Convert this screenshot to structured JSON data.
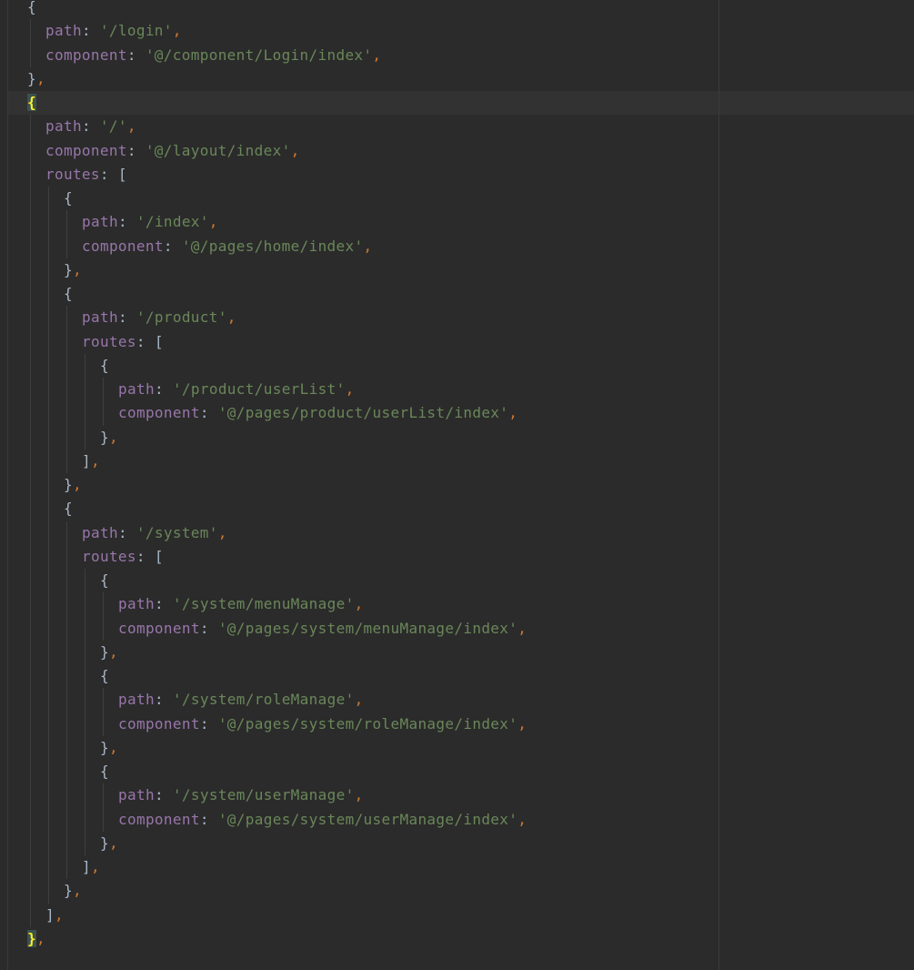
{
  "editor": {
    "language": "javascript",
    "colors": {
      "background": "#2b2b2b",
      "key": "#9876aa",
      "string": "#6a8759",
      "comma": "#cc7832",
      "bracket": "#a9b7c6",
      "matched_brace": "#ffef28",
      "current_line": "#323232"
    },
    "current_line_index": 4,
    "lines": [
      {
        "indent": 0,
        "tokens": [
          {
            "t": "b",
            "v": "{"
          }
        ]
      },
      {
        "indent": 1,
        "tokens": [
          {
            "t": "k",
            "v": "path"
          },
          {
            "t": "p",
            "v": ": "
          },
          {
            "t": "s",
            "v": "'/login'"
          },
          {
            "t": "c",
            "v": ","
          }
        ]
      },
      {
        "indent": 1,
        "tokens": [
          {
            "t": "k",
            "v": "component"
          },
          {
            "t": "p",
            "v": ": "
          },
          {
            "t": "s",
            "v": "'@/component/Login/index'"
          },
          {
            "t": "c",
            "v": ","
          }
        ]
      },
      {
        "indent": 0,
        "tokens": [
          {
            "t": "b",
            "v": "}"
          },
          {
            "t": "c",
            "v": ","
          }
        ]
      },
      {
        "indent": 0,
        "tokens": [
          {
            "t": "bm",
            "v": "{"
          }
        ]
      },
      {
        "indent": 1,
        "tokens": [
          {
            "t": "k",
            "v": "path"
          },
          {
            "t": "p",
            "v": ": "
          },
          {
            "t": "s",
            "v": "'/'"
          },
          {
            "t": "c",
            "v": ","
          }
        ]
      },
      {
        "indent": 1,
        "tokens": [
          {
            "t": "k",
            "v": "component"
          },
          {
            "t": "p",
            "v": ": "
          },
          {
            "t": "s",
            "v": "'@/layout/index'"
          },
          {
            "t": "c",
            "v": ","
          }
        ]
      },
      {
        "indent": 1,
        "tokens": [
          {
            "t": "k",
            "v": "routes"
          },
          {
            "t": "p",
            "v": ": "
          },
          {
            "t": "b",
            "v": "["
          }
        ]
      },
      {
        "indent": 2,
        "tokens": [
          {
            "t": "b",
            "v": "{"
          }
        ]
      },
      {
        "indent": 3,
        "tokens": [
          {
            "t": "k",
            "v": "path"
          },
          {
            "t": "p",
            "v": ": "
          },
          {
            "t": "s",
            "v": "'/index'"
          },
          {
            "t": "c",
            "v": ","
          }
        ]
      },
      {
        "indent": 3,
        "tokens": [
          {
            "t": "k",
            "v": "component"
          },
          {
            "t": "p",
            "v": ": "
          },
          {
            "t": "s",
            "v": "'@/pages/home/index'"
          },
          {
            "t": "c",
            "v": ","
          }
        ]
      },
      {
        "indent": 2,
        "tokens": [
          {
            "t": "b",
            "v": "}"
          },
          {
            "t": "c",
            "v": ","
          }
        ]
      },
      {
        "indent": 2,
        "tokens": [
          {
            "t": "b",
            "v": "{"
          }
        ]
      },
      {
        "indent": 3,
        "tokens": [
          {
            "t": "k",
            "v": "path"
          },
          {
            "t": "p",
            "v": ": "
          },
          {
            "t": "s",
            "v": "'/product'"
          },
          {
            "t": "c",
            "v": ","
          }
        ]
      },
      {
        "indent": 3,
        "tokens": [
          {
            "t": "k",
            "v": "routes"
          },
          {
            "t": "p",
            "v": ": "
          },
          {
            "t": "b",
            "v": "["
          }
        ]
      },
      {
        "indent": 4,
        "tokens": [
          {
            "t": "b",
            "v": "{"
          }
        ]
      },
      {
        "indent": 5,
        "tokens": [
          {
            "t": "k",
            "v": "path"
          },
          {
            "t": "p",
            "v": ": "
          },
          {
            "t": "s",
            "v": "'/product/userList'"
          },
          {
            "t": "c",
            "v": ","
          }
        ]
      },
      {
        "indent": 5,
        "tokens": [
          {
            "t": "k",
            "v": "component"
          },
          {
            "t": "p",
            "v": ": "
          },
          {
            "t": "s",
            "v": "'@/pages/product/userList/index'"
          },
          {
            "t": "c",
            "v": ","
          }
        ]
      },
      {
        "indent": 4,
        "tokens": [
          {
            "t": "b",
            "v": "}"
          },
          {
            "t": "c",
            "v": ","
          }
        ]
      },
      {
        "indent": 3,
        "tokens": [
          {
            "t": "b",
            "v": "]"
          },
          {
            "t": "c",
            "v": ","
          }
        ]
      },
      {
        "indent": 2,
        "tokens": [
          {
            "t": "b",
            "v": "}"
          },
          {
            "t": "c",
            "v": ","
          }
        ]
      },
      {
        "indent": 2,
        "tokens": [
          {
            "t": "b",
            "v": "{"
          }
        ]
      },
      {
        "indent": 3,
        "tokens": [
          {
            "t": "k",
            "v": "path"
          },
          {
            "t": "p",
            "v": ": "
          },
          {
            "t": "s",
            "v": "'/system'"
          },
          {
            "t": "c",
            "v": ","
          }
        ]
      },
      {
        "indent": 3,
        "tokens": [
          {
            "t": "k",
            "v": "routes"
          },
          {
            "t": "p",
            "v": ": "
          },
          {
            "t": "b",
            "v": "["
          }
        ]
      },
      {
        "indent": 4,
        "tokens": [
          {
            "t": "b",
            "v": "{"
          }
        ]
      },
      {
        "indent": 5,
        "tokens": [
          {
            "t": "k",
            "v": "path"
          },
          {
            "t": "p",
            "v": ": "
          },
          {
            "t": "s",
            "v": "'/system/menuManage'"
          },
          {
            "t": "c",
            "v": ","
          }
        ]
      },
      {
        "indent": 5,
        "tokens": [
          {
            "t": "k",
            "v": "component"
          },
          {
            "t": "p",
            "v": ": "
          },
          {
            "t": "s",
            "v": "'@/pages/system/menuManage/index'"
          },
          {
            "t": "c",
            "v": ","
          }
        ]
      },
      {
        "indent": 4,
        "tokens": [
          {
            "t": "b",
            "v": "}"
          },
          {
            "t": "c",
            "v": ","
          }
        ]
      },
      {
        "indent": 4,
        "tokens": [
          {
            "t": "b",
            "v": "{"
          }
        ]
      },
      {
        "indent": 5,
        "tokens": [
          {
            "t": "k",
            "v": "path"
          },
          {
            "t": "p",
            "v": ": "
          },
          {
            "t": "s",
            "v": "'/system/roleManage'"
          },
          {
            "t": "c",
            "v": ","
          }
        ]
      },
      {
        "indent": 5,
        "tokens": [
          {
            "t": "k",
            "v": "component"
          },
          {
            "t": "p",
            "v": ": "
          },
          {
            "t": "s",
            "v": "'@/pages/system/roleManage/index'"
          },
          {
            "t": "c",
            "v": ","
          }
        ]
      },
      {
        "indent": 4,
        "tokens": [
          {
            "t": "b",
            "v": "}"
          },
          {
            "t": "c",
            "v": ","
          }
        ]
      },
      {
        "indent": 4,
        "tokens": [
          {
            "t": "b",
            "v": "{"
          }
        ]
      },
      {
        "indent": 5,
        "tokens": [
          {
            "t": "k",
            "v": "path"
          },
          {
            "t": "p",
            "v": ": "
          },
          {
            "t": "s",
            "v": "'/system/userManage'"
          },
          {
            "t": "c",
            "v": ","
          }
        ]
      },
      {
        "indent": 5,
        "tokens": [
          {
            "t": "k",
            "v": "component"
          },
          {
            "t": "p",
            "v": ": "
          },
          {
            "t": "s",
            "v": "'@/pages/system/userManage/index'"
          },
          {
            "t": "c",
            "v": ","
          }
        ]
      },
      {
        "indent": 4,
        "tokens": [
          {
            "t": "b",
            "v": "}"
          },
          {
            "t": "c",
            "v": ","
          }
        ]
      },
      {
        "indent": 3,
        "tokens": [
          {
            "t": "b",
            "v": "]"
          },
          {
            "t": "c",
            "v": ","
          }
        ]
      },
      {
        "indent": 2,
        "tokens": [
          {
            "t": "b",
            "v": "}"
          },
          {
            "t": "c",
            "v": ","
          }
        ]
      },
      {
        "indent": 1,
        "tokens": [
          {
            "t": "b",
            "v": "]"
          },
          {
            "t": "c",
            "v": ","
          }
        ]
      },
      {
        "indent": 0,
        "tokens": [
          {
            "t": "bm",
            "v": "}"
          },
          {
            "t": "c",
            "v": ","
          }
        ]
      }
    ]
  }
}
